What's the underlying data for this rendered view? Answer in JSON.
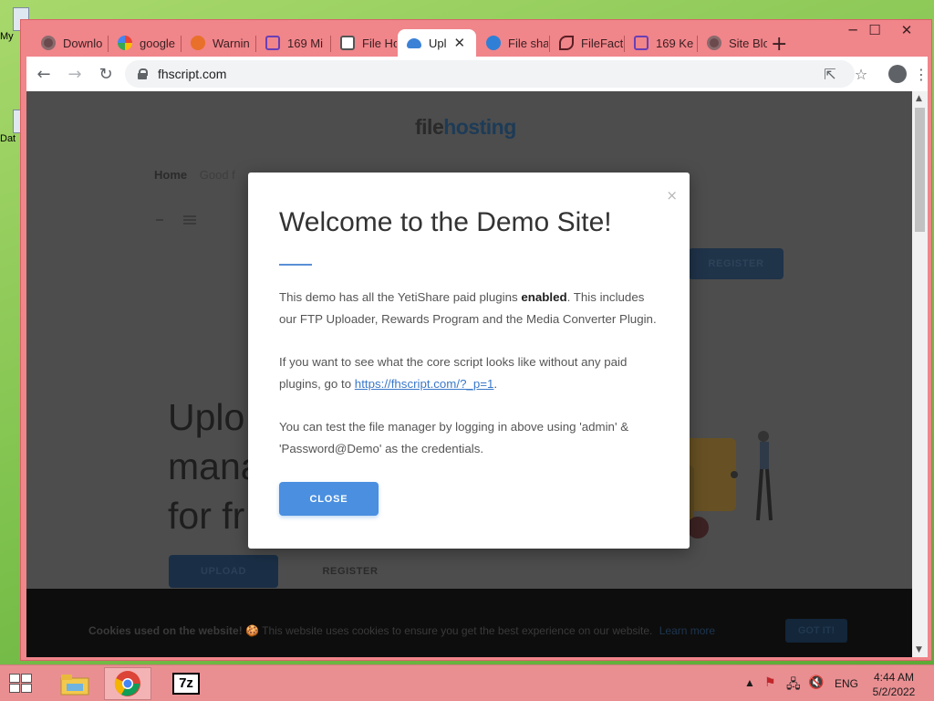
{
  "desktop": {
    "icons": [
      {
        "label": "My",
        "icon": "computer-icon"
      },
      {
        "label": "Dat",
        "icon": "folder-icon"
      }
    ]
  },
  "browser": {
    "tabs": [
      {
        "label": "Downlo",
        "icon": "globe-icon",
        "active": false
      },
      {
        "label": "google",
        "icon": "google-icon",
        "active": false
      },
      {
        "label": "Warnin",
        "icon": "warning-site-icon",
        "active": false
      },
      {
        "label": "169 Mi",
        "icon": "square-site-icon",
        "active": false
      },
      {
        "label": "File Ho",
        "icon": "file-host-icon",
        "active": false
      },
      {
        "label": "Upl",
        "icon": "cloud-upload-icon",
        "active": true
      },
      {
        "label": "File sha",
        "icon": "file-share-icon",
        "active": false
      },
      {
        "label": "FileFact",
        "icon": "filefactory-icon",
        "active": false
      },
      {
        "label": "169 Ke",
        "icon": "square-site-icon",
        "active": false
      },
      {
        "label": "Site Blo",
        "icon": "globe-icon",
        "active": false
      }
    ],
    "new_tab_label": "+",
    "address": "fhscript.com",
    "controls": {
      "minimize": "─",
      "maximize": "☐",
      "close": "✕"
    }
  },
  "page": {
    "logo_a": "file",
    "logo_b": "hosting",
    "breadcrumb_home": "Home",
    "breadcrumb_rest": "Good f",
    "register_top": "REGISTER",
    "hero_lines": [
      "Uplo",
      "mana",
      "for fr"
    ],
    "upload_button": "UPLOAD",
    "register_button": "REGISTER",
    "cookie": {
      "heading": "Cookies used on the website!",
      "emoji": "🍪",
      "text": "This website uses cookies to ensure you get the best experience on our website.",
      "learn_more": "Learn more",
      "got_it": "GOT IT!"
    }
  },
  "modal": {
    "title": "Welcome to the Demo Site!",
    "close_x": "×",
    "p1_pre": "This demo has all the YetiShare paid plugins ",
    "p1_bold": "enabled",
    "p1_post": ". This includes our FTP Uploader, Rewards Program and the Media Converter Plugin.",
    "p2_pre": "If you want to see what the core script looks like without any paid plugins, go to ",
    "p2_link": "https://fhscript.com/?_p=1",
    "p2_post": ".",
    "p3": "You can test the file manager by logging in above using 'admin' & 'Password@Demo' as the credentials.",
    "button": "CLOSE"
  },
  "taskbar": {
    "language": "ENG",
    "time": "4:44 AM",
    "date": "5/2/2022",
    "apps": [
      {
        "name": "file-explorer-icon"
      },
      {
        "name": "chrome-icon"
      },
      {
        "name": "7zip-icon",
        "label": "7z"
      }
    ]
  },
  "colors": {
    "window_frame": "#f0858a",
    "modal_button": "#4a8fe0",
    "link": "#3a78c9",
    "taskbar": "#e98f92"
  }
}
